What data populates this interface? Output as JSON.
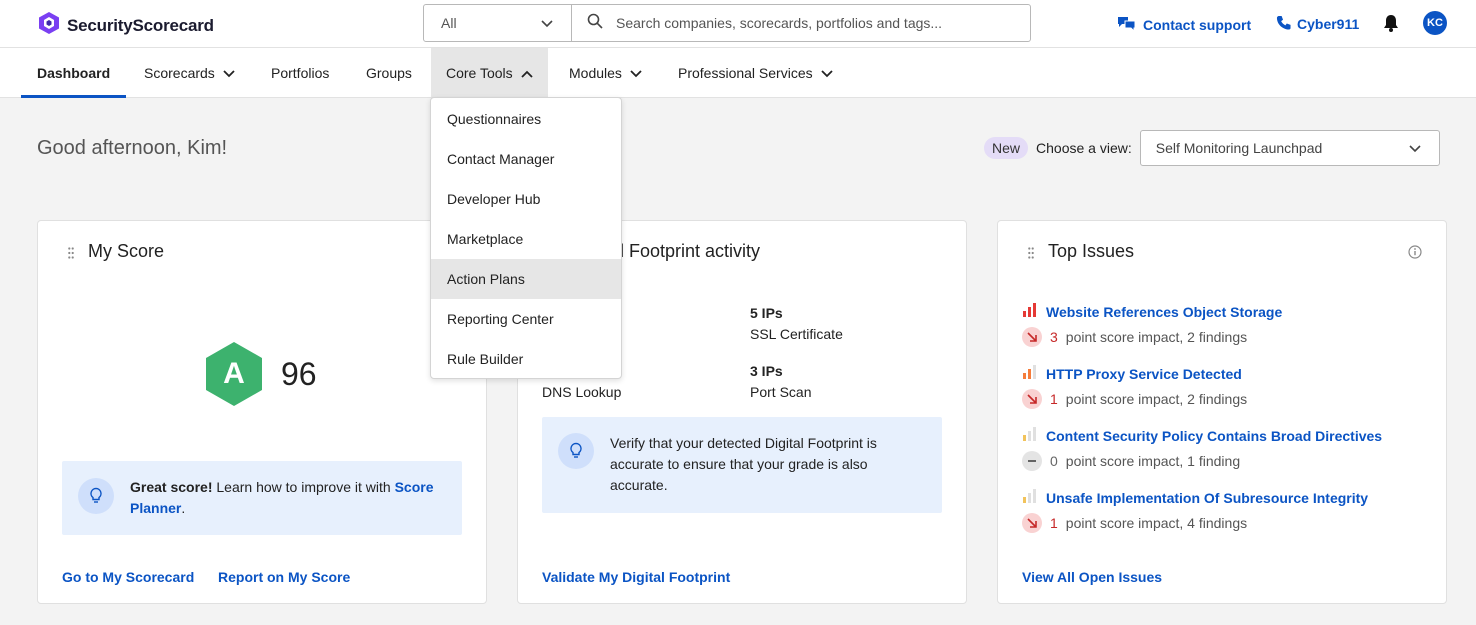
{
  "brand": {
    "name": "SecurityScorecard"
  },
  "search": {
    "scope": "All",
    "placeholder": "Search companies, scorecards, portfolios and tags..."
  },
  "header": {
    "contact_support": "Contact support",
    "cyber911": "Cyber911",
    "avatar_initials": "KC"
  },
  "nav": {
    "items": [
      {
        "label": "Dashboard"
      },
      {
        "label": "Scorecards"
      },
      {
        "label": "Portfolios"
      },
      {
        "label": "Groups"
      },
      {
        "label": "Core Tools"
      },
      {
        "label": "Modules"
      },
      {
        "label": "Professional Services"
      }
    ]
  },
  "core_tools_menu": [
    "Questionnaires",
    "Contact Manager",
    "Developer Hub",
    "Marketplace",
    "Action Plans",
    "Reporting Center",
    "Rule Builder"
  ],
  "greeting": "Good afternoon, Kim!",
  "view": {
    "badge": "New",
    "label": "Choose a view:",
    "selected": "Self Monitoring Launchpad"
  },
  "my_score": {
    "title": "My Score",
    "grade": "A",
    "score": "96",
    "tip_bold": "Great score!",
    "tip_text": " Learn how to improve it with ",
    "tip_link": "Score Planner",
    "tip_end": ".",
    "link_scorecard": "Go to My Scorecard",
    "link_report": "Report on My Score"
  },
  "footprint": {
    "title_visible": "l Footprint activity",
    "stats": [
      {
        "value": "5 IPs",
        "label": "SSL Certificate"
      },
      {
        "value": "",
        "label": "DNS Lookup"
      },
      {
        "value": "3 IPs",
        "label": "Port Scan"
      }
    ],
    "tip": "Verify that your detected Digital Footprint is accurate to ensure that your grade is also accurate.",
    "link": "Validate My Digital Footprint"
  },
  "top_issues": {
    "title": "Top Issues",
    "items": [
      {
        "title": "Website References Object Storage",
        "impact": "3",
        "meta": "point score impact, 2 findings",
        "severity": "high"
      },
      {
        "title": "HTTP Proxy Service Detected",
        "impact": "1",
        "meta": "point score impact, 2 findings",
        "severity": "medium"
      },
      {
        "title": "Content Security Policy Contains Broad Directives",
        "impact": "0",
        "meta": "point score impact, 1 finding",
        "severity": "low"
      },
      {
        "title": "Unsafe Implementation Of Subresource Integrity",
        "impact": "1",
        "meta": "point score impact, 4 findings",
        "severity": "low"
      }
    ],
    "link": "View All Open Issues"
  },
  "colors": {
    "accent": "#0b54c4",
    "grade_green": "#3db26e",
    "severity_red": "#e53935",
    "severity_orange": "#f57c3b",
    "severity_yellow": "#f2c35b"
  }
}
